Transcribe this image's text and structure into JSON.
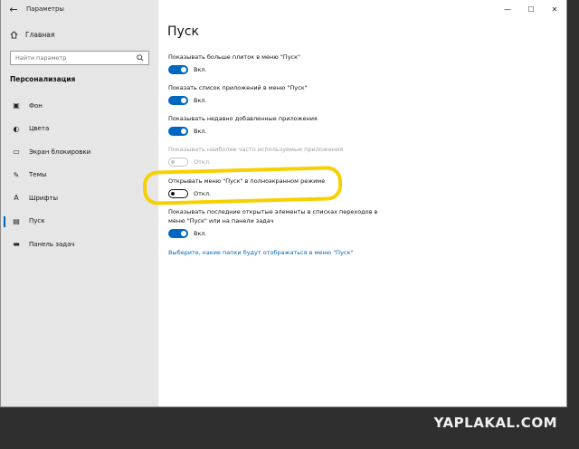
{
  "window": {
    "title": "Параметры",
    "back_glyph": "←",
    "controls": {
      "minimize": "—",
      "maximize": "☐",
      "close": "✕"
    }
  },
  "sidebar": {
    "home": "Главная",
    "search_placeholder": "Найти параметр",
    "section_title": "Персонализация",
    "items": [
      {
        "label": "Фон",
        "icon": "picture-icon",
        "glyph": "▣",
        "active": false
      },
      {
        "label": "Цвета",
        "icon": "palette-icon",
        "glyph": "◐",
        "active": false
      },
      {
        "label": "Экран блокировки",
        "icon": "lock-screen-icon",
        "glyph": "▭",
        "active": false
      },
      {
        "label": "Темы",
        "icon": "brush-icon",
        "glyph": "✎",
        "active": false
      },
      {
        "label": "Шрифты",
        "icon": "font-icon",
        "glyph": "A",
        "active": false
      },
      {
        "label": "Пуск",
        "icon": "start-icon",
        "glyph": "▤",
        "active": true
      },
      {
        "label": "Панель задач",
        "icon": "taskbar-icon",
        "glyph": "▬",
        "active": false
      }
    ]
  },
  "main": {
    "title": "Пуск",
    "settings": [
      {
        "label": "Показывать больше плиток в меню \"Пуск\"",
        "state": "Вкл.",
        "on": true,
        "disabled": false
      },
      {
        "label": "Показать список приложений в меню \"Пуск\"",
        "state": "Вкл.",
        "on": true,
        "disabled": false
      },
      {
        "label": "Показывать недавно добавленные приложения",
        "state": "Вкл.",
        "on": true,
        "disabled": false
      },
      {
        "label": "Показывать наиболее часто используемые приложения",
        "state": "Откл.",
        "on": false,
        "disabled": true
      },
      {
        "label": "Открывать меню \"Пуск\" в полноэкранном режиме",
        "state": "Откл.",
        "on": false,
        "disabled": false
      },
      {
        "label_line1": "Показывать последние открытые элементы в списках переходов в",
        "label_line2": "меню \"Пуск\" или на панели задач",
        "state": "Вкл.",
        "on": true,
        "disabled": false
      }
    ],
    "link": "Выберите, какие папки будут отображаться в меню \"Пуск\""
  },
  "watermark": "YAPLAKAL.COM",
  "colors": {
    "accent": "#0067c0",
    "highlight": "#f7d000",
    "sidebar": "#e6e6e6"
  }
}
